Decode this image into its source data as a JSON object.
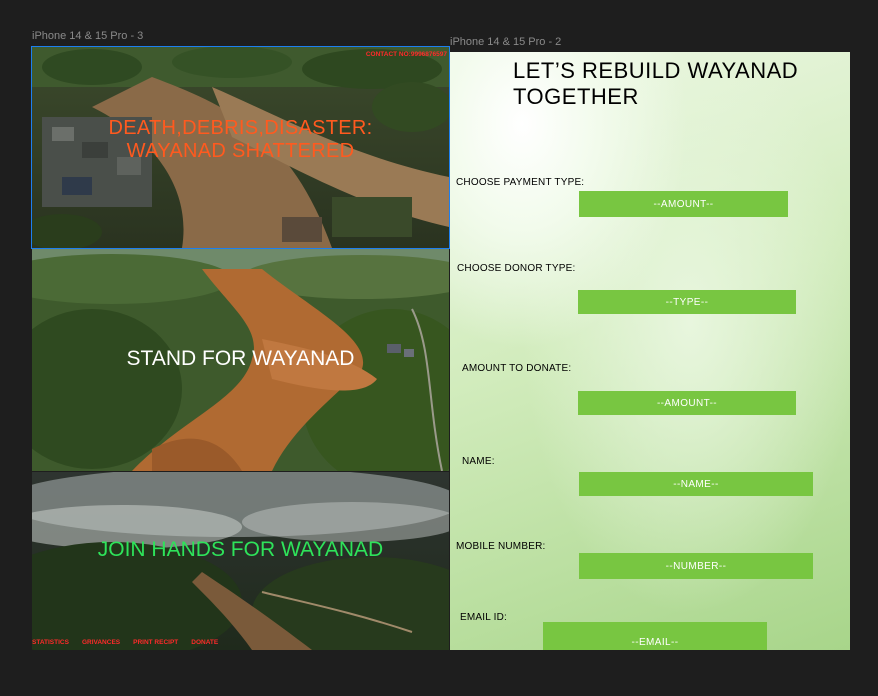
{
  "frames": {
    "left_label": "iPhone 14 & 15 Pro - 3",
    "right_label": "iPhone 14 & 15 Pro - 2"
  },
  "left": {
    "contact": "CONTACT NO:9996876597",
    "headline_1_line1": "DEATH,DEBRIS,DISASTER:",
    "headline_1_line2": "WAYANAD SHATTERED",
    "headline_2": "STAND FOR WAYANAD",
    "headline_3": "JOIN HANDS FOR WAYANAD",
    "nav": [
      "STATISTICS",
      "GRIVANCES",
      "PRINT RECIPT",
      "DONATE"
    ],
    "colors": {
      "headline_1": "#ff5a1f",
      "headline_2": "#ffffff",
      "headline_3": "#2ee35a",
      "nav": "#ff2a2a",
      "selection": "#1d7ff0"
    }
  },
  "right": {
    "title_line1": "LET’S REBUILD WAYANAD",
    "title_line2": "TOGETHER",
    "fields": [
      {
        "label": "CHOOSE PAYMENT TYPE:",
        "placeholder": "--AMOUNT--"
      },
      {
        "label": "CHOOSE DONOR TYPE:",
        "placeholder": "--TYPE--"
      },
      {
        "label": "AMOUNT TO DONATE:",
        "placeholder": "--AMOUNT--"
      },
      {
        "label": "NAME:",
        "placeholder": "--NAME--"
      },
      {
        "label": "MOBILE NUMBER:",
        "placeholder": "--NUMBER--"
      },
      {
        "label": "EMAIL ID:",
        "placeholder": "--EMAIL--"
      }
    ],
    "colors": {
      "field": "#78c641",
      "background": "#d2ecbd"
    }
  }
}
